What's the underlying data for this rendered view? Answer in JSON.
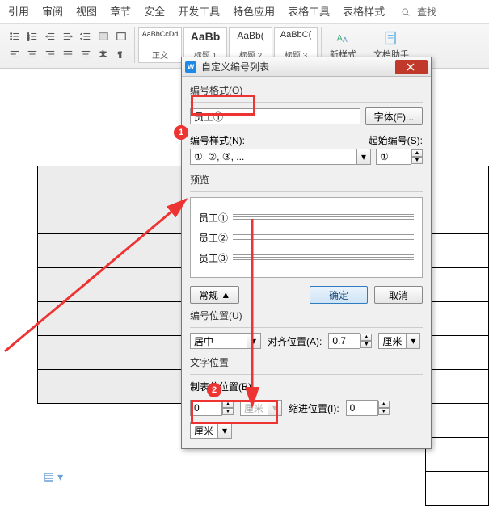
{
  "menu": [
    "引用",
    "审阅",
    "视图",
    "章节",
    "安全",
    "开发工具",
    "特色应用",
    "表格工具",
    "表格样式"
  ],
  "find": {
    "label": "查找"
  },
  "styles": [
    {
      "preview": "AaBbCcDd",
      "label": "正文",
      "cls": ""
    },
    {
      "preview": "AaBb",
      "label": "标题 1",
      "cls": "aa"
    },
    {
      "preview": "AaBb(",
      "label": "标题 2",
      "cls": ""
    },
    {
      "preview": "AaBbC(",
      "label": "标题 3",
      "cls": ""
    }
  ],
  "ribbon_right": {
    "new_style": "新样式",
    "assist": "文档助手"
  },
  "dialog": {
    "title": "自定义编号列表",
    "sect_format": "编号格式(O)",
    "format_value": "员工①",
    "font_btn": "字体(F)...",
    "style_label": "编号样式(N):",
    "style_value": "①, ②, ③, ...",
    "start_label": "起始编号(S):",
    "start_value": "①",
    "preview_label": "预览",
    "preview_lines": [
      "员工①",
      "员工②",
      "员工③"
    ],
    "normal_btn": "常规",
    "ok": "确定",
    "cancel": "取消",
    "pos_label": "编号位置(U)",
    "pos_value": "居中",
    "align_label": "对齐位置(A):",
    "align_value": "0.7",
    "unit": "厘米",
    "text_pos_label": "文字位置",
    "tab_label": "制表位位置(B)",
    "tab_value": "0",
    "indent_label": "缩进位置(I):",
    "indent_value": "0"
  },
  "annot": {
    "b1": "1",
    "b2": "2"
  }
}
